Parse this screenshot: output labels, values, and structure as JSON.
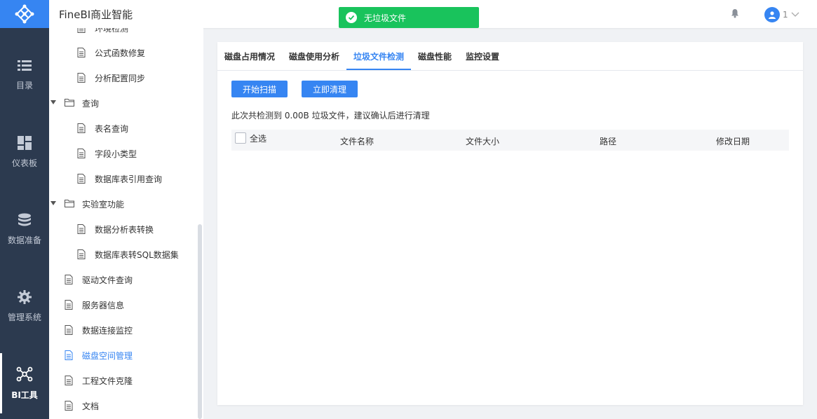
{
  "nav": {
    "items": [
      {
        "label": "目录",
        "icon": "list-icon"
      },
      {
        "label": "仪表板",
        "icon": "dashboard-icon"
      },
      {
        "label": "数据准备",
        "icon": "database-icon"
      },
      {
        "label": "管理系统",
        "icon": "gear-icon"
      },
      {
        "label": "BI工具",
        "icon": "network-icon"
      }
    ]
  },
  "header": {
    "title": "FineBI商业智能",
    "user_name": "1"
  },
  "toast": {
    "text": "无垃圾文件"
  },
  "tree": {
    "items": [
      {
        "label": "环境检测"
      },
      {
        "label": "公式函数修复"
      },
      {
        "label": "分析配置同步"
      },
      {
        "label": "查询"
      },
      {
        "label": "表名查询"
      },
      {
        "label": "字段小类型"
      },
      {
        "label": "数据库表引用查询"
      },
      {
        "label": "实验室功能"
      },
      {
        "label": "数据分析表转换"
      },
      {
        "label": "数据库表转SQL数据集"
      },
      {
        "label": "驱动文件查询"
      },
      {
        "label": "服务器信息"
      },
      {
        "label": "数据连接监控"
      },
      {
        "label": "磁盘空间管理"
      },
      {
        "label": "工程文件克隆"
      },
      {
        "label": "文档"
      }
    ]
  },
  "tabs": [
    "磁盘占用情况",
    "磁盘使用分析",
    "垃圾文件检测",
    "磁盘性能",
    "监控设置"
  ],
  "actions": {
    "scan": "开始扫描",
    "clean": "立即清理"
  },
  "summary": "此次共检测到 0.00B 垃圾文件，建议确认后进行清理",
  "table": {
    "select_all": "全选",
    "columns": [
      "文件名称",
      "文件大小",
      "路径",
      "修改日期"
    ]
  },
  "colors": {
    "primary": "#3685f2",
    "nav_bg": "#2c3a4f",
    "success": "#19c35c"
  }
}
